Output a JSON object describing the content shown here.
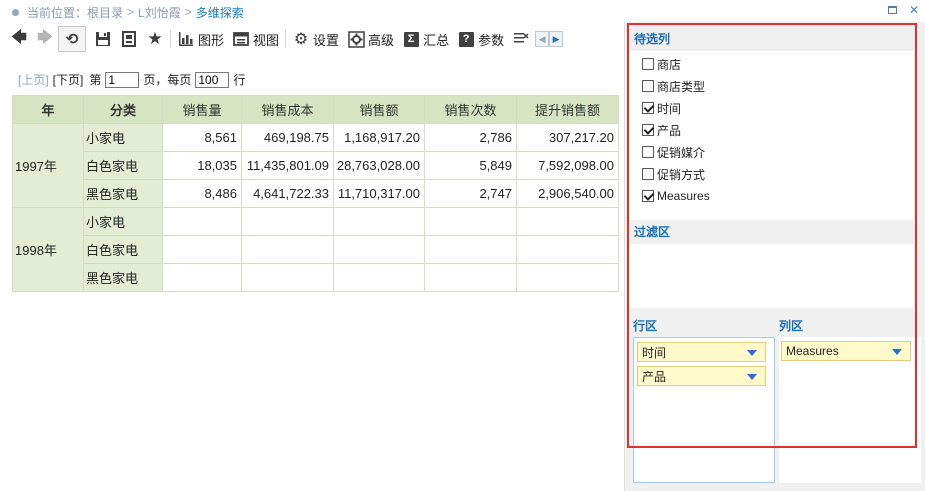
{
  "breadcrumb": {
    "label": "当前位置：",
    "items": [
      "根目录",
      "L刘怡霞",
      "多维探索"
    ],
    "separator": ">"
  },
  "toolbar": {
    "chart": "图形",
    "view": "视图",
    "settings": "设置",
    "advanced": "高级",
    "summary": "汇总",
    "params": "参数",
    "truncated": " Ⅱ"
  },
  "pager": {
    "prev": "[上页]",
    "next": "[下页]",
    "page_prefix": "第",
    "page_value": "1",
    "page_suffix": "页，每页",
    "per_page_value": "100",
    "row_suffix": "行"
  },
  "table": {
    "headers": [
      "年",
      "分类",
      "销售量",
      "销售成本",
      "销售额",
      "销售次数",
      "提升销售额"
    ],
    "groups": [
      {
        "year": "1997年",
        "rows": [
          {
            "category": "小家电",
            "values": [
              "8,561",
              "469,198.75",
              "1,168,917.20",
              "2,786",
              "307,217.20"
            ]
          },
          {
            "category": "白色家电",
            "values": [
              "18,035",
              "11,435,801.09",
              "28,763,028.00",
              "5,849",
              "7,592,098.00"
            ]
          },
          {
            "category": "黑色家电",
            "values": [
              "8,486",
              "4,641,722.33",
              "11,710,317.00",
              "2,747",
              "2,906,540.00"
            ]
          }
        ]
      },
      {
        "year": "1998年",
        "rows": [
          {
            "category": "小家电",
            "values": [
              "",
              "",
              "",
              "",
              ""
            ]
          },
          {
            "category": "白色家电",
            "values": [
              "",
              "",
              "",
              "",
              ""
            ]
          },
          {
            "category": "黑色家电",
            "values": [
              "",
              "",
              "",
              "",
              ""
            ]
          }
        ]
      }
    ]
  },
  "panel": {
    "candidates_title": "待选列",
    "candidates": [
      {
        "label": "商店",
        "checked": false
      },
      {
        "label": "商店类型",
        "checked": false
      },
      {
        "label": "时间",
        "checked": true
      },
      {
        "label": "产品",
        "checked": true
      },
      {
        "label": "促销媒介",
        "checked": false
      },
      {
        "label": "促销方式",
        "checked": false
      },
      {
        "label": "Measures",
        "checked": true
      }
    ],
    "filter_title": "过滤区",
    "row_area_title": "行区",
    "col_area_title": "列区",
    "row_items": [
      "时间",
      "产品"
    ],
    "col_items": [
      "Measures"
    ]
  },
  "colors": {
    "accent": "#1a6fb8",
    "highlight_border": "#e03030",
    "header_green": "#d6e4c2",
    "chip_bg": "#fff9cc"
  }
}
